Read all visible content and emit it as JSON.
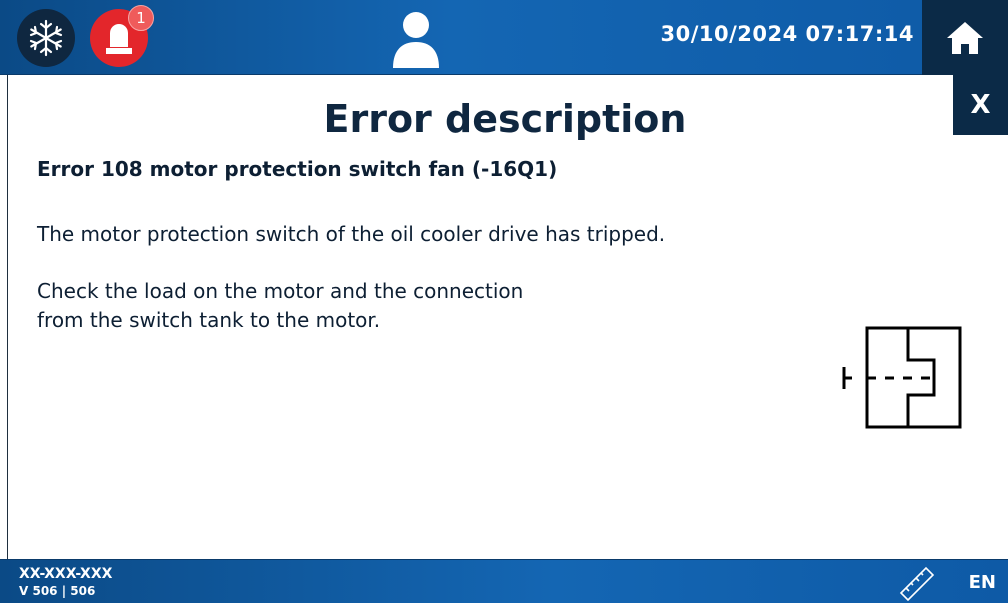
{
  "header": {
    "snowflake_icon": "snowflake-icon",
    "alarm_icon": "alarm-light-icon",
    "alarm_count": "1",
    "user_icon": "user-icon",
    "datetime": "30/10/2024 07:17:14",
    "home_icon": "home-icon"
  },
  "dialog": {
    "close_label": "X",
    "title": "Error description",
    "error_title": "Error 108 motor protection switch fan (-16Q1)",
    "description": "The motor protection switch of the oil cooler drive has tripped.",
    "hint_lines": [
      "Check the load on the motor and the connection",
      "from the switch tank to the motor."
    ],
    "symbol_icon": "motor-protection-switch-symbol"
  },
  "footer": {
    "machine_id": "XX-XXX-XXX",
    "version": "V 506 | 506",
    "ruler_icon": "ruler-icon",
    "language": "EN"
  },
  "colors": {
    "header_blue": "#1466b3",
    "dark_navy": "#0b2a47",
    "alarm_red": "#e3262b"
  }
}
